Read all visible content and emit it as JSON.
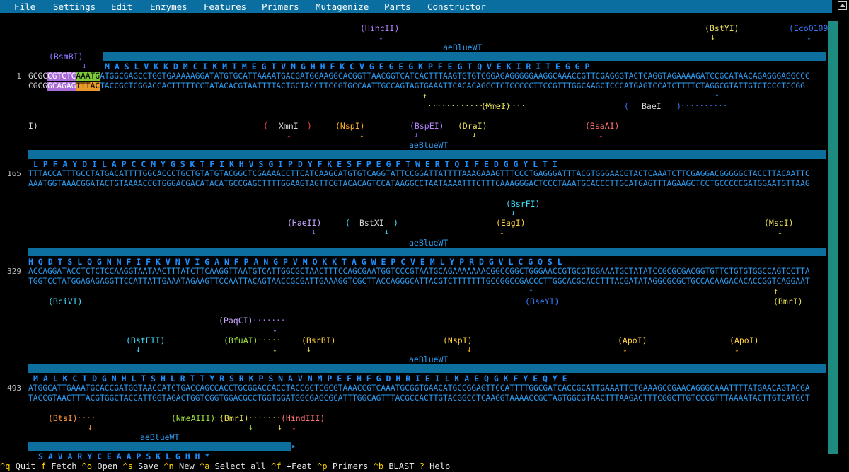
{
  "menu": {
    "items": [
      "File",
      "Settings",
      "Edit",
      "Enzymes",
      "Features",
      "Primers",
      "Mutagenize",
      "Parts",
      "Constructor"
    ]
  },
  "colors": {
    "menubar": "#0a6fa0",
    "seq_blue": "#2b9bf0",
    "feature_bar": "#0c6f9e",
    "scroll_thumb": "#1e8a80"
  },
  "feature_name": "aeBlueWT",
  "blocks": [
    {
      "line_number": "1",
      "aa": "M A S L V K K D M C I K M T M E G T V N G H H F K C V G E G E G K P F E G T Q V E K I R I T E G G P",
      "top_strand_pre": "GCGC",
      "top_hl1": "CGTCTC",
      "top_hl2": "AAATG",
      "top_strand_post": "ATGGCGAGCCTGGTGAAAAAGGATATGTGCATTAAAATGACGATGGAAGGCACGGTTAACGGTCATCACTTTAAGTGTGTCGGAGAGGGGGAAGGCAAACCGTTCGAGGGTACTCAGGTAGAAAAGATCCGCATAACAGAGGGAGGCCC",
      "bottom_strand_pre": "CGCG",
      "bottom_hl1": "GCAGAG",
      "bottom_hl2": "TTTAC",
      "bottom_strand_post": "TACCGCTCGGACCACTTTTTCCTATACACGTAATTTTACTGCTACCTTCCGTGCCAATTGCCAGTAGTGAAATTCACACAGCCTCTCCCCCTTCCGTTTGGCAAGCTCCCATGAGTCCATCTTTTCTAGGCGTATTGTCTCCCTCCGG"
    },
    {
      "line_number": "165",
      "aa": "L P F A Y D I L A P C C M Y G S K T F I K H V S G I P D Y F K E S F P E G F T W E R T Q I F E D G G Y L T I",
      "top_strand": "TTTACCATTTGCCTATGACATTTTGGCACCCTGCTGTATGTACGGCTCGAAAACCTTCATCAAGCATGTGTCAGGTATTCCGGATTATTTTAAAGAAAGTTTCCCTGAGGGATTTACGTGGGAACGTACTCAAATCTTCGAGGACGGGGGCTACCTTACAATTC",
      "bottom_strand": "AAATGGTAAACGGATACTGTAAAACCGTGGGACGACATACATGCCGAGCTTTTGGAAGTAGTTCGTACACAGTCCATAAGGCCTAATAAAATTTCTTTCAAAGGGACTCCCTAAATGCACCCTTGCATGAGTTTAGAAGCTCCTGCCCCCGATGGAATGTTAAG"
    },
    {
      "line_number": "329",
      "aa": "H Q D T S L Q G N N F I F K V N V I G A N F P A N G P V M Q K K T A G W E P C V E M L Y P R D G V L C G Q S L",
      "top_strand": "ACCAGGATACCTCTCTCCAAGGTAATAACTTTATCTTCAAGGTTAATGTCATTGGCGCTAACTTTCCAGCGAATGGTCCCGTAATGCAGAAAAAAACGGCCGGCTGGGAACCGTGCGTGGAAATGCTATATCCGCGCGACGGTGTTCTGTGTGGCCAGTCCTTA",
      "bottom_strand": "TGGTCCTATGGAGAGAGGTTCCATTATTGAAATAGAAGTTCCAATTACAGTAACCGCGATTGAAAGGTCGCTTACCAGGGCATTACGTCTTTTTTTGCCGGCCGACCCTTGGCACGCACCTTTACGATATAGGCGCGCTGCCACAAGACACACCGGTCAGGAAT"
    },
    {
      "line_number": "493",
      "aa": "M A L K C T D G N H L T S H L R T T Y R S R K P S N A V N M P E F H F G D H R I E I L K A E Q G K F Y E Q Y E",
      "top_strand": "ATGGCATTGAAATGCACCGATGGTAACCATCTGACCAGCCACCTGCGGACCACCTACCGCTCGCGTAAACCGTCAAATGCGGTGAACATGCCGGAGTTCCATTTTGGCGATCACCGCATTGAAATTCTGAAAGCCGAACAGGGCAAATTTTATGAACAGTACGA",
      "bottom_strand": "TACCGTAACTTTACGTGGCTACCATTGGTAGACTGGTCGGTGGACGCCTGGTGGATGGCGAGCGCATTTGGCAGTTTACGCCACTTGTACGGCCTCAAGGTAAAACCGCTAGTGGCGTAACTTTAAGACTTTCGGCTTGTCCCGTTTAAAATACTTGTCATGCT"
    },
    {
      "aa": "S A V A R Y C E A A P S K L G H H *"
    }
  ],
  "enzymes": {
    "HincII": "(HincII)",
    "BstYI": "(BstYI)",
    "Eco0109": "(Eco0109",
    "BsmBI": "(BsmBI)",
    "MmeI": "(MmeI)",
    "BaeI_l": "(",
    "BaeI": "BaeI",
    "BaeI_r": ")",
    "I": "I)",
    "XmnI_l": "(",
    "XmnI": "XmnI",
    "XmnI_r": ")",
    "NspI": "(NspI)",
    "BspEI": "(BspEI)",
    "DraI": "(DraI)",
    "BsaAI": "(BsaAI)",
    "BsrFI": "(BsrFI)",
    "HaeII": "(HaeII)",
    "BstXI_l": "(",
    "BstXI": "BstXI",
    "BstXI_r": ")",
    "EagI": "(EagI)",
    "MscI": "(MscI)",
    "BciVI": "(BciVI)",
    "BseYI": "(BseYI)",
    "BmrI": "(BmrI)",
    "PaqCI": "(PaqCI)",
    "BstEII": "(BstEII)",
    "BfuAI": "(BfuAI)",
    "BsrBI": "(BsrBI)",
    "NspI2": "(NspI)",
    "ApoI": "(ApoI)",
    "ApoI2": "(ApoI)",
    "BtsI": "(BtsI)",
    "NmeAIII": "(NmeAIII)",
    "BmrI2": "(BmrI)",
    "HindIII": "(HindIII)"
  },
  "statusbar": [
    {
      "key": "^q",
      "desc": "Quit"
    },
    {
      "key": "f",
      "desc": "Fetch"
    },
    {
      "key": "^o",
      "desc": "Open"
    },
    {
      "key": "^s",
      "desc": "Save"
    },
    {
      "key": "^n",
      "desc": "New"
    },
    {
      "key": "^a",
      "desc": "Select all"
    },
    {
      "key": "^f",
      "desc": "+Feat"
    },
    {
      "key": "^p",
      "desc": "Primers"
    },
    {
      "key": "^b",
      "desc": "BLAST"
    },
    {
      "key": "?",
      "desc": "Help"
    }
  ]
}
